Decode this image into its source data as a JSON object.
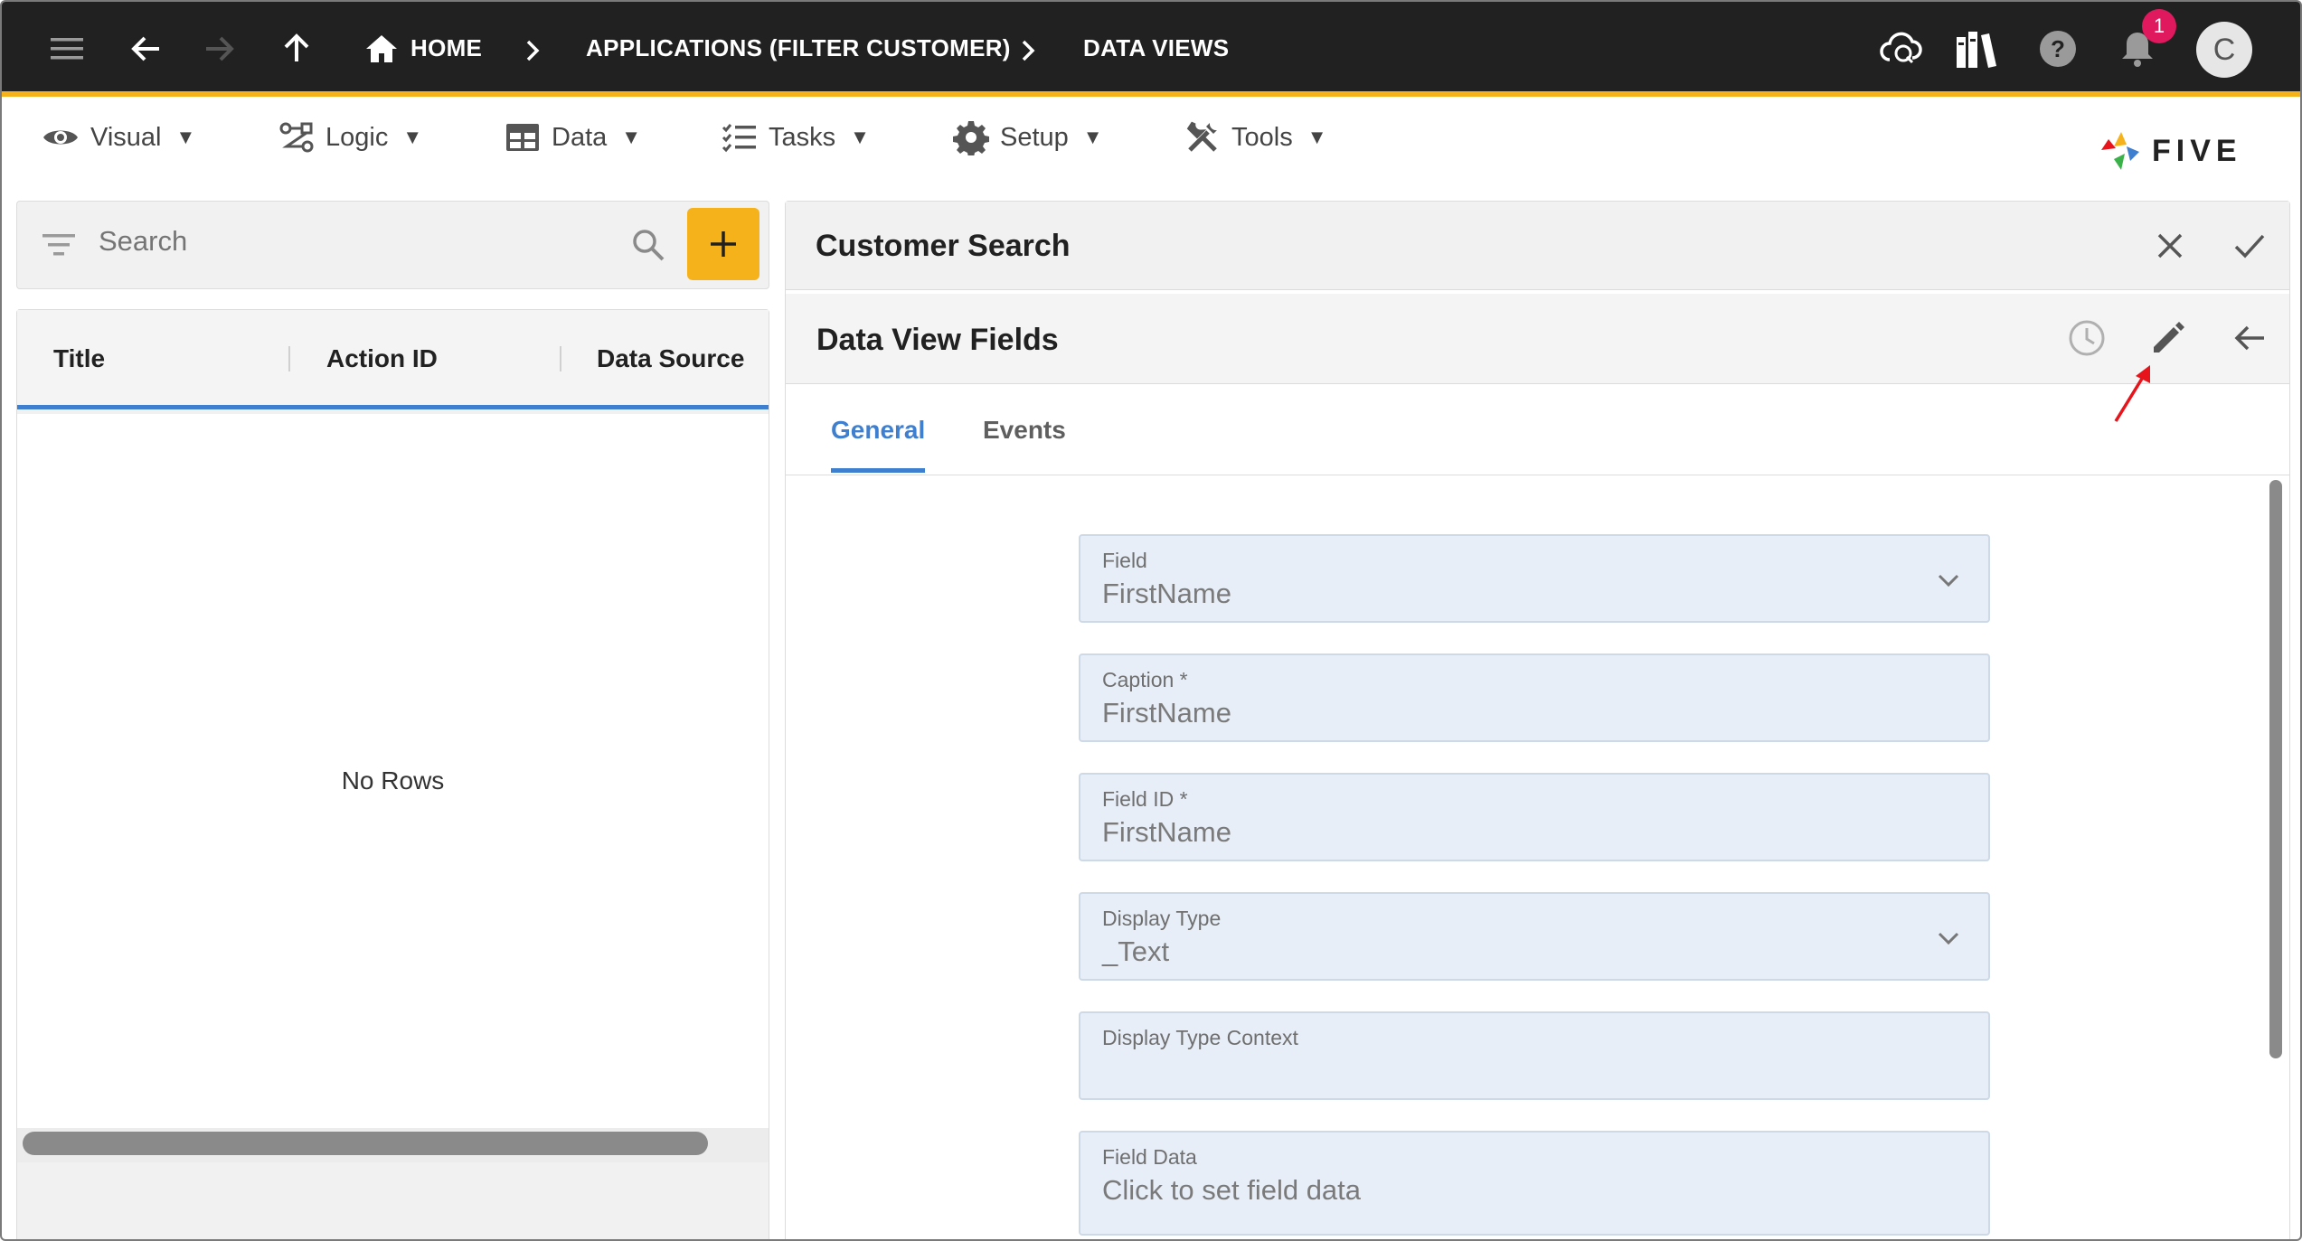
{
  "topbar": {
    "breadcrumbs": [
      "HOME",
      "APPLICATIONS (FILTER CUSTOMER)",
      "DATA VIEWS"
    ],
    "notification_count": "1",
    "avatar_initial": "C",
    "icons": [
      "menu-icon",
      "back-icon",
      "forward-icon",
      "up-icon",
      "home-icon",
      "cloud-sync-icon",
      "library-icon",
      "help-icon",
      "bell-icon"
    ]
  },
  "menu": {
    "items": [
      {
        "label": "Visual",
        "icon": "eye-icon"
      },
      {
        "label": "Logic",
        "icon": "logic-icon"
      },
      {
        "label": "Data",
        "icon": "table-icon"
      },
      {
        "label": "Tasks",
        "icon": "tasks-icon"
      },
      {
        "label": "Setup",
        "icon": "gear-icon"
      },
      {
        "label": "Tools",
        "icon": "tools-icon"
      }
    ],
    "caret": "▼",
    "logo_text": "FIVE"
  },
  "left": {
    "search_placeholder": "Search",
    "add_label": "+",
    "columns": [
      "Title",
      "Action ID",
      "Data Source"
    ],
    "empty_text": "No Rows"
  },
  "right": {
    "form_title": "Customer Search",
    "subform_title": "Data View Fields",
    "tabs": [
      {
        "label": "General",
        "active": true
      },
      {
        "label": "Events",
        "active": false
      }
    ],
    "fields": [
      {
        "label": "Field",
        "value": "FirstName",
        "dropdown": true
      },
      {
        "label": "Caption *",
        "value": "FirstName",
        "dropdown": false
      },
      {
        "label": "Field ID *",
        "value": "FirstName",
        "dropdown": false
      },
      {
        "label": "Display Type",
        "value": "_Text",
        "dropdown": true
      },
      {
        "label": "Display Type Context",
        "value": "",
        "dropdown": false
      },
      {
        "label": "Field Data",
        "value": "Click to set field data",
        "dropdown": false
      }
    ]
  },
  "colors": {
    "topbar_bg": "#212121",
    "accent_yellow": "#f6b21a",
    "accent_blue": "#3f7fd0",
    "field_bg": "#e7eef7",
    "badge": "#e0195e",
    "annotation_arrow": "#e8141c"
  }
}
